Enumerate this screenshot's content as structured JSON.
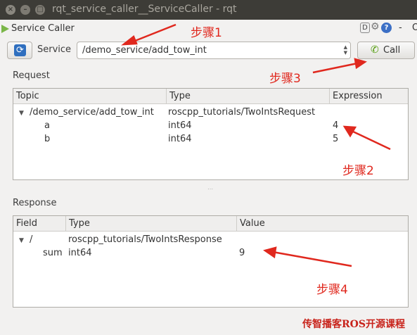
{
  "window": {
    "title": "rqt_service_caller__ServiceCaller - rqt"
  },
  "plugin": {
    "title": "Service Caller",
    "help_icon": "?",
    "d_label": "D",
    "close_glyph": "-",
    "float_glyph": "O"
  },
  "toolbar": {
    "service_label": "Service",
    "service_value": "/demo_service/add_tow_int",
    "call_label": "Call"
  },
  "request": {
    "label": "Request",
    "columns": [
      "Topic",
      "Type",
      "Expression"
    ],
    "rows": [
      {
        "topic": "/demo_service/add_tow_int",
        "type": "roscpp_tutorials/TwoIntsRequest",
        "expression": ""
      },
      {
        "topic": "a",
        "type": "int64",
        "expression": "4"
      },
      {
        "topic": "b",
        "type": "int64",
        "expression": "5"
      }
    ]
  },
  "response": {
    "label": "Response",
    "columns": [
      "Field",
      "Type",
      "Value"
    ],
    "rows": [
      {
        "field": "/",
        "type": "roscpp_tutorials/TwoIntsResponse",
        "value": ""
      },
      {
        "field": "sum",
        "type": "int64",
        "value": "9"
      }
    ]
  },
  "annotations": {
    "step1": "步骤1",
    "step2": "步骤2",
    "step3": "步骤3",
    "step4": "步骤4",
    "color": "#e0281e"
  },
  "watermark": "传智播客ROS开源课程"
}
